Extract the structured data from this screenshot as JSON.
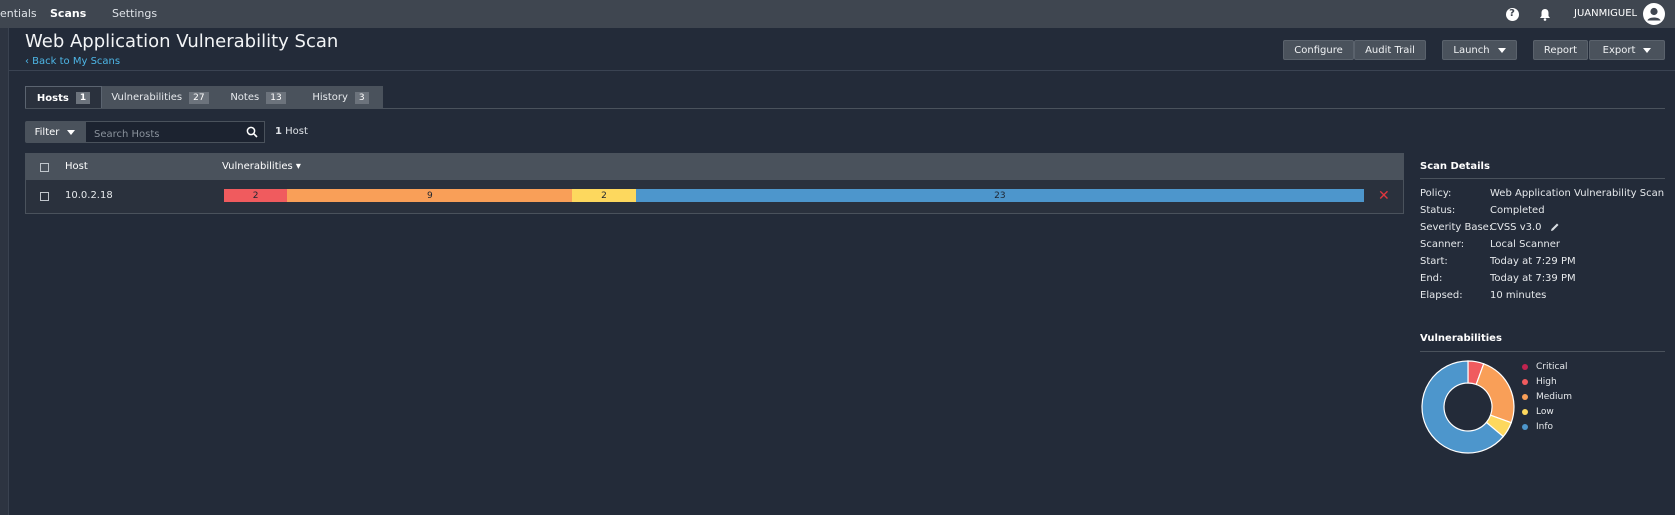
{
  "nav": {
    "items": [
      "entials",
      "Scans",
      "Settings"
    ],
    "user": "JUANMIGUEL"
  },
  "header": {
    "title": "Web Application Vulnerability Scan",
    "back_link": "‹ Back to My Scans",
    "buttons": {
      "configure": "Configure",
      "audit_trail": "Audit Trail",
      "launch": "Launch",
      "report": "Report",
      "export": "Export"
    }
  },
  "tabs": [
    {
      "label": "Hosts",
      "count": "1"
    },
    {
      "label": "Vulnerabilities",
      "count": "27"
    },
    {
      "label": "Notes",
      "count": "13"
    },
    {
      "label": "History",
      "count": "3"
    }
  ],
  "filter": {
    "button_label": "Filter",
    "search_placeholder": "Search Hosts",
    "count_number": "1",
    "count_label": "Host"
  },
  "table": {
    "headers": {
      "host": "Host",
      "vulnerabilities": "Vulnerabilities ▾"
    },
    "rows": [
      {
        "host": "10.0.2.18",
        "bar": [
          {
            "severity": "High",
            "count": "2",
            "color": "#f05b5e"
          },
          {
            "severity": "Medium",
            "count": "9",
            "color": "#f99f58"
          },
          {
            "severity": "Low",
            "count": "2",
            "color": "#fdd85e"
          },
          {
            "severity": "Info",
            "count": "23",
            "color": "#4d96cc"
          }
        ]
      }
    ]
  },
  "scan_details": {
    "title": "Scan Details",
    "rows": [
      {
        "key": "Policy:",
        "value": "Web Application Vulnerability Scan"
      },
      {
        "key": "Status:",
        "value": "Completed"
      },
      {
        "key": "Severity Base:",
        "value": "CVSS v3.0"
      },
      {
        "key": "Scanner:",
        "value": "Local Scanner"
      },
      {
        "key": "Start:",
        "value": "Today at 7:29 PM"
      },
      {
        "key": "End:",
        "value": "Today at 7:39 PM"
      },
      {
        "key": "Elapsed:",
        "value": "10 minutes"
      }
    ]
  },
  "vulnerabilities_chart": {
    "title": "Vulnerabilities",
    "legend": [
      {
        "label": "Critical",
        "color": "#c0234f"
      },
      {
        "label": "High",
        "color": "#f05b5e"
      },
      {
        "label": "Medium",
        "color": "#f99f58"
      },
      {
        "label": "Low",
        "color": "#fdd85e"
      },
      {
        "label": "Info",
        "color": "#4d96cc"
      }
    ],
    "values": [
      0,
      2,
      9,
      2,
      23
    ]
  }
}
